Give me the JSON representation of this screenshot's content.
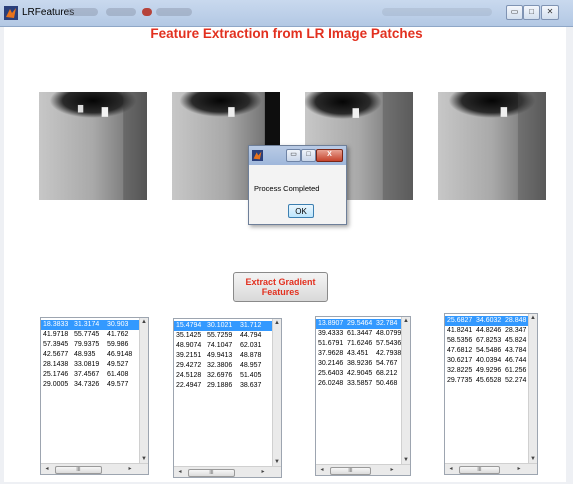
{
  "window": {
    "title": "LRFeatures",
    "minimize_label": "▭",
    "maximize_label": "□",
    "close_label": "✕"
  },
  "heading": "Feature Extraction from LR Image Patches",
  "dialog": {
    "message": "Process Completed",
    "ok_label": "OK",
    "close_label": "X"
  },
  "extract_button_label": "Extract Gradient Features",
  "listboxes": [
    {
      "rows": [
        [
          "18.3833",
          "31.3174",
          "30.903"
        ],
        [
          "41.9718",
          "55.7745",
          "41.762"
        ],
        [
          "57.3945",
          "79.9375",
          "59.986"
        ],
        [
          "42.5677",
          "48.935",
          "46.9148"
        ],
        [
          "28.1438",
          "33.0819",
          "49.527"
        ],
        [
          "25.1746",
          "37.4567",
          "61.408"
        ],
        [
          "29.0005",
          "34.7326",
          "49.577"
        ]
      ]
    },
    {
      "rows": [
        [
          "15.4794",
          "30.1021",
          "31.712"
        ],
        [
          "35.1425",
          "55.7259",
          "44.794"
        ],
        [
          "48.9074",
          "74.1047",
          "62.031"
        ],
        [
          "39.2151",
          "49.9413",
          "48.878"
        ],
        [
          "29.4272",
          "32.3806",
          "48.957"
        ],
        [
          "24.5128",
          "32.6976",
          "51.405"
        ],
        [
          "22.4947",
          "29.1886",
          "38.637"
        ]
      ]
    },
    {
      "rows": [
        [
          "13.8907",
          "29.5464",
          "32.784"
        ],
        [
          "39.4333",
          "61.3447",
          "48.0799"
        ],
        [
          "51.6791",
          "71.6246",
          "57.5436"
        ],
        [
          "37.9628",
          "43.451",
          "42.7938"
        ],
        [
          "30.2146",
          "38.9236",
          "54.767"
        ],
        [
          "25.6403",
          "42.9045",
          "68.212"
        ],
        [
          "26.0248",
          "33.5857",
          "50.468"
        ]
      ]
    },
    {
      "rows": [
        [
          "25.6827",
          "34.6032",
          "28.848"
        ],
        [
          "41.8241",
          "44.8246",
          "28.347"
        ],
        [
          "58.5356",
          "67.8253",
          "45.824"
        ],
        [
          "47.6812",
          "54.5486",
          "43.784"
        ],
        [
          "30.6217",
          "40.0394",
          "46.744"
        ],
        [
          "32.8225",
          "49.9296",
          "61.256"
        ],
        [
          "29.7735",
          "45.6528",
          "52.274"
        ]
      ]
    }
  ],
  "scroll": {
    "up": "▲",
    "down": "▼",
    "left": "◂",
    "right": "▸",
    "thumb": "III"
  }
}
